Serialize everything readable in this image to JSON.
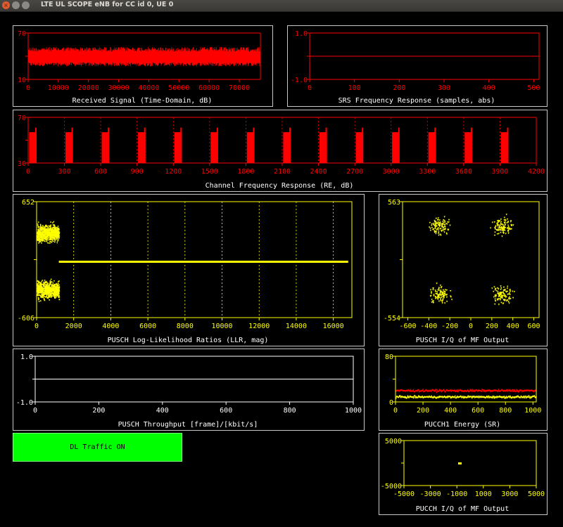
{
  "window": {
    "title": "LTE UL SCOPE eNB for CC  id 0, UE 0"
  },
  "colors": {
    "red": "#ff0000",
    "yellow": "#ffff00",
    "axis_red": "#ff0000",
    "axis_yellow": "#ffff00",
    "white": "#ffffff",
    "button_green": "#00ff00"
  },
  "dl_button": {
    "label": "DL Traffic ON"
  },
  "plots": {
    "received_signal": {
      "title": "Received Signal (Time-Domain, dB)",
      "y_ticks": [
        "70",
        "10"
      ],
      "x_ticks": [
        "0",
        "10000",
        "20000",
        "30000",
        "40000",
        "50000",
        "60000",
        "70000"
      ]
    },
    "srs": {
      "title": "SRS Frequency Response (samples, abs)",
      "y_ticks": [
        "1.0",
        "-1.0"
      ],
      "x_ticks": [
        "0",
        "100",
        "200",
        "300",
        "400",
        "500"
      ]
    },
    "channel_freq": {
      "title": "Channel Frequency  Response (RE, dB)",
      "y_ticks": [
        "70",
        "30"
      ],
      "x_ticks": [
        "0",
        "300",
        "600",
        "900",
        "1200",
        "1500",
        "1800",
        "2100",
        "2400",
        "2700",
        "3000",
        "3300",
        "3600",
        "3900",
        "4200"
      ]
    },
    "llr": {
      "title": "PUSCH Log-Likelihood Ratios (LLR, mag)",
      "y_ticks": [
        "652",
        "-606"
      ],
      "x_ticks": [
        "0",
        "2000",
        "4000",
        "6000",
        "8000",
        "10000",
        "12000",
        "14000",
        "16000"
      ]
    },
    "pusch_iq": {
      "title": "PUSCH I/Q of MF Output",
      "y_ticks": [
        "563",
        "-554"
      ],
      "x_ticks": [
        "-600",
        "-400",
        "-200",
        "0",
        "200",
        "400",
        "600"
      ]
    },
    "throughput": {
      "title": "PUSCH Throughput [frame]/[kbit/s]",
      "y_ticks": [
        "1.0",
        "-1.0"
      ],
      "x_ticks": [
        "0",
        "200",
        "400",
        "600",
        "800",
        "1000"
      ]
    },
    "pucch1_energy": {
      "title": "PUCCH1 Energy (SR)",
      "y_ticks": [
        "80",
        "0"
      ],
      "x_ticks": [
        "0",
        "200",
        "400",
        "600",
        "800",
        "1000"
      ]
    },
    "pucch_iq": {
      "title": "PUCCH I/Q of MF Output",
      "y_ticks": [
        "5000",
        "-5000"
      ],
      "x_ticks": [
        "-5000",
        "-3000",
        "-1000",
        "1000",
        "3000",
        "5000"
      ]
    }
  },
  "chart_data": [
    {
      "type": "area",
      "title": "Received Signal (Time-Domain, dB)",
      "xlim": [
        0,
        77000
      ],
      "ylim": [
        10,
        70
      ],
      "series": [
        {
          "values_range": [
            27,
            52
          ]
        }
      ]
    },
    {
      "type": "line",
      "title": "SRS Frequency Response (samples, abs)",
      "xlim": [
        0,
        512
      ],
      "ylim": [
        -1.0,
        1.0
      ],
      "series": [
        {
          "constant": 0
        }
      ]
    },
    {
      "type": "bar",
      "title": "Channel Frequency  Response (RE, dB)",
      "xlim": [
        0,
        4200
      ],
      "ylim": [
        30,
        70
      ],
      "x": [
        0,
        300,
        600,
        900,
        1200,
        1500,
        1800,
        2100,
        2400,
        2700,
        3000,
        3300,
        3600,
        3900
      ],
      "values": [
        57,
        57,
        57,
        57,
        57,
        57,
        57,
        57,
        57,
        57,
        57,
        57,
        57,
        57
      ]
    },
    {
      "type": "scatter",
      "title": "PUSCH Log-Likelihood Ratios (LLR, mag)",
      "xlim": [
        0,
        17000
      ],
      "ylim": [
        -606,
        652
      ],
      "series": [
        {
          "x_range": [
            0,
            1200
          ],
          "clusters_y": [
            310,
            -300
          ]
        },
        {
          "x_range": [
            1200,
            16800
          ],
          "constant": 0
        }
      ]
    },
    {
      "type": "scatter",
      "title": "PUSCH I/Q of MF Output",
      "xlim": [
        -650,
        650
      ],
      "ylim": [
        -554,
        563
      ],
      "series": [
        {
          "cluster_centers": [
            [
              -300,
              330
            ],
            [
              300,
              330
            ],
            [
              -300,
              -330
            ],
            [
              300,
              -330
            ]
          ]
        }
      ]
    },
    {
      "type": "line",
      "title": "PUSCH Throughput [frame]/[kbit/s]",
      "xlim": [
        0,
        1000
      ],
      "ylim": [
        -1.0,
        1.0
      ],
      "series": [
        {
          "constant": 0
        }
      ]
    },
    {
      "type": "scatter",
      "title": "PUCCH1 Energy (SR)",
      "xlim": [
        0,
        1024
      ],
      "ylim": [
        0,
        80
      ],
      "series": [
        {
          "color": "#ff0000",
          "level": 21
        },
        {
          "color": "#ffff00",
          "level": 10
        }
      ]
    },
    {
      "type": "scatter",
      "title": "PUCCH I/Q of MF Output",
      "xlim": [
        -5000,
        5000
      ],
      "ylim": [
        -5000,
        5000
      ],
      "series": [
        {
          "points": [
            [
              -800,
              0
            ]
          ]
        }
      ]
    }
  ]
}
